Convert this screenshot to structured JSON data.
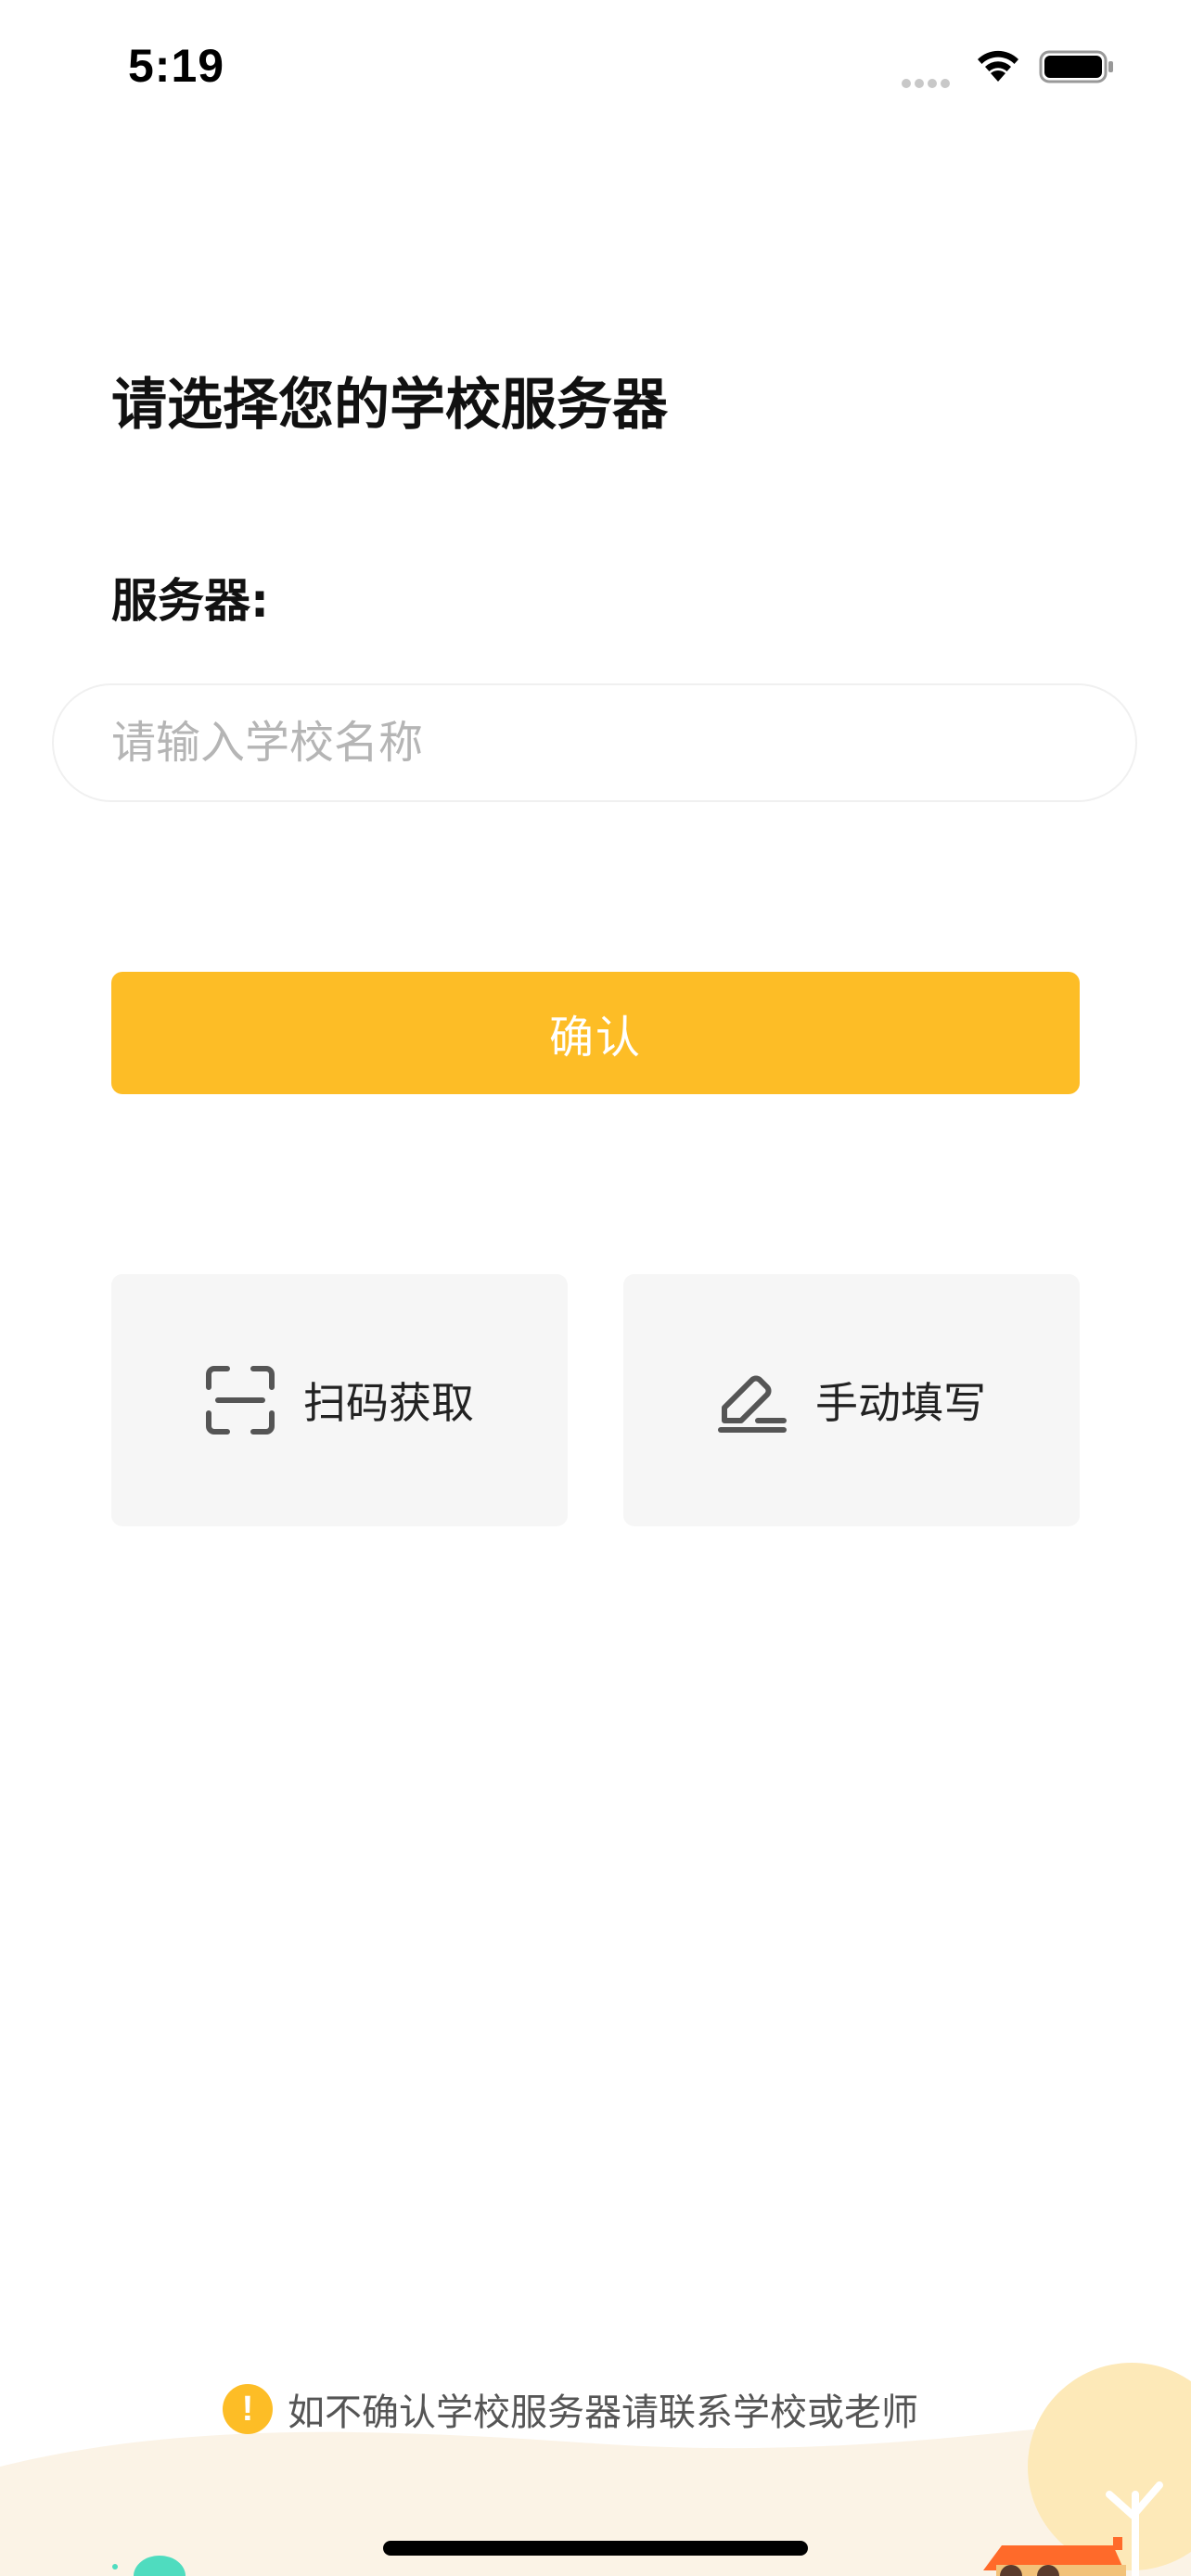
{
  "status_bar": {
    "time": "5:19"
  },
  "page": {
    "title": "请选择您的学校服务器",
    "server_label": "服务器:"
  },
  "search": {
    "placeholder": "请输入学校名称",
    "value": ""
  },
  "confirm": {
    "label": "确认"
  },
  "options": {
    "scan_label": "扫码获取",
    "manual_label": "手动填写"
  },
  "notice": {
    "text": "如不确认学校服务器请联系学校或老师",
    "icon": "!"
  },
  "colors": {
    "accent": "#fdbd26",
    "card_bg": "#f6f6f6",
    "placeholder": "#b5b5b5"
  },
  "icons": {
    "wifi": "wifi-icon",
    "battery": "battery-icon",
    "scan": "scan-icon",
    "edit": "edit-icon",
    "warning": "warning-icon"
  }
}
